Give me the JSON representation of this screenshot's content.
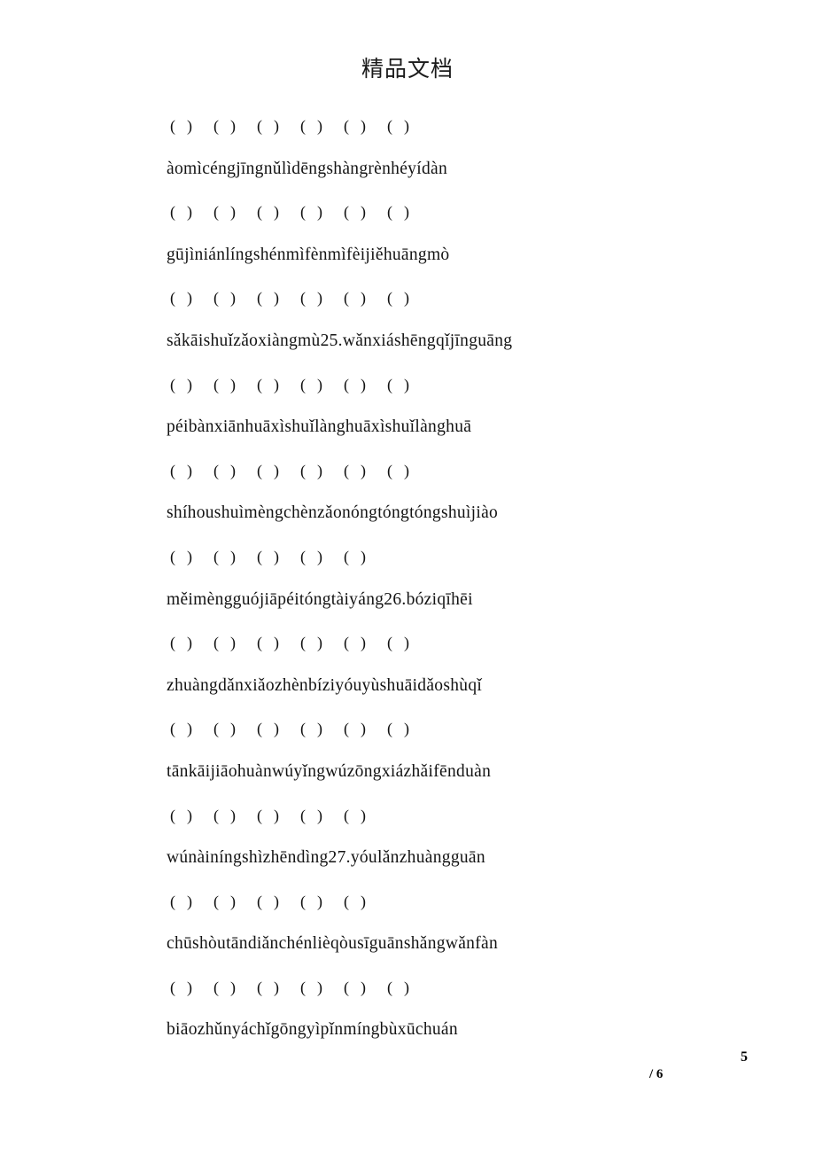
{
  "document": {
    "title": "精品文档",
    "paren_glyphs": {
      "left": "(",
      "right": ")"
    }
  },
  "content": {
    "rows": [
      {
        "type": "parens",
        "count": 6
      },
      {
        "type": "pinyin",
        "text": "àomìcéngjīngnǔlìdēngshàngrènhéyídàn"
      },
      {
        "type": "parens",
        "count": 6
      },
      {
        "type": "pinyin",
        "text": "gūjìniánlíngshénmìfènmìfèijiěhuāngmò"
      },
      {
        "type": "parens",
        "count": 6
      },
      {
        "type": "pinyin",
        "text": "sǎkāishuǐzǎoxiàngmù25.wǎnxiáshēngqǐjīnguāng"
      },
      {
        "type": "parens",
        "count": 6
      },
      {
        "type": "pinyin",
        "text": "péibànxiānhuāxìshuǐlànghuāxìshuǐlànghuā"
      },
      {
        "type": "parens",
        "count": 6
      },
      {
        "type": "pinyin",
        "text": "shíhoushuìmèngchènzǎonóngtóngtóngshuìjiào"
      },
      {
        "type": "parens",
        "count": 5
      },
      {
        "type": "pinyin",
        "text": "měimèngguójiāpéitóngtàiyáng26.bóziqīhēi"
      },
      {
        "type": "parens",
        "count": 6
      },
      {
        "type": "pinyin",
        "text": "zhuàngdǎnxiǎozhènbíziyóuyùshuāidǎoshùqǐ"
      },
      {
        "type": "parens",
        "count": 6
      },
      {
        "type": "pinyin",
        "text": "tānkāijiāohuànwúyǐngwúzōngxiázhǎifēnduàn"
      },
      {
        "type": "parens",
        "count": 5
      },
      {
        "type": "pinyin",
        "text": "wúnàiníngshìzhēndìng27.yóulǎnzhuàngguān"
      },
      {
        "type": "parens",
        "count": 5
      },
      {
        "type": "pinyin",
        "text": "chūshòutāndiǎnchénlièqòusīguānshǎngwǎnfàn"
      },
      {
        "type": "parens",
        "count": 6
      },
      {
        "type": "pinyin",
        "text": "biāozhǔnyáchǐgōngyìpǐnmíngbùxūchuán"
      }
    ]
  },
  "footer": {
    "page_number": "5",
    "total_pages": "/ 6"
  }
}
